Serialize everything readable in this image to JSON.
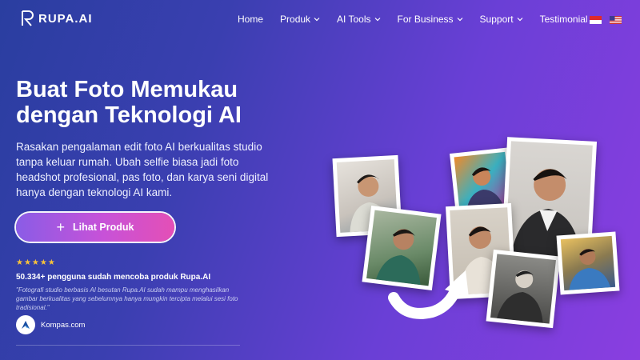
{
  "brand": {
    "name": "RUPA.AI"
  },
  "nav": {
    "items": [
      {
        "label": "Home",
        "has_dropdown": false
      },
      {
        "label": "Produk",
        "has_dropdown": true
      },
      {
        "label": "AI Tools",
        "has_dropdown": true
      },
      {
        "label": "For Business",
        "has_dropdown": true
      },
      {
        "label": "Support",
        "has_dropdown": true
      },
      {
        "label": "Testimonial",
        "has_dropdown": false
      }
    ],
    "languages": [
      {
        "code": "id",
        "icon": "indonesia-flag-icon"
      },
      {
        "code": "en",
        "icon": "us-flag-icon"
      }
    ]
  },
  "hero": {
    "title": "Buat Foto Memukau dengan Teknologi AI",
    "subtitle": "Rasakan pengalaman edit foto AI berkualitas studio tanpa keluar rumah. Ubah selfie biasa jadi foto headshot profesional, pas foto, dan karya seni digital hanya dengan teknologi AI kami.",
    "cta_label": "Lihat Produk",
    "rating_stars": "★★★★★",
    "rating_value": 5,
    "users_text": "50.334+ pengguna sudah mencoba produk Rupa.AI",
    "quote": "\"Fotografi studio berbasis AI besutan Rupa.AI sudah mampu menghasilkan gambar berkualitas yang sebelumnya hanya mungkin tercipta melalui sesi foto tradisional.\"",
    "quote_source": "Kompas.com"
  },
  "colors": {
    "bg_start": "#2a3ea0",
    "bg_end": "#8a3ee0",
    "cta_start": "#8a5ce6",
    "cta_end": "#e44fb6",
    "star": "#f7c23b"
  }
}
